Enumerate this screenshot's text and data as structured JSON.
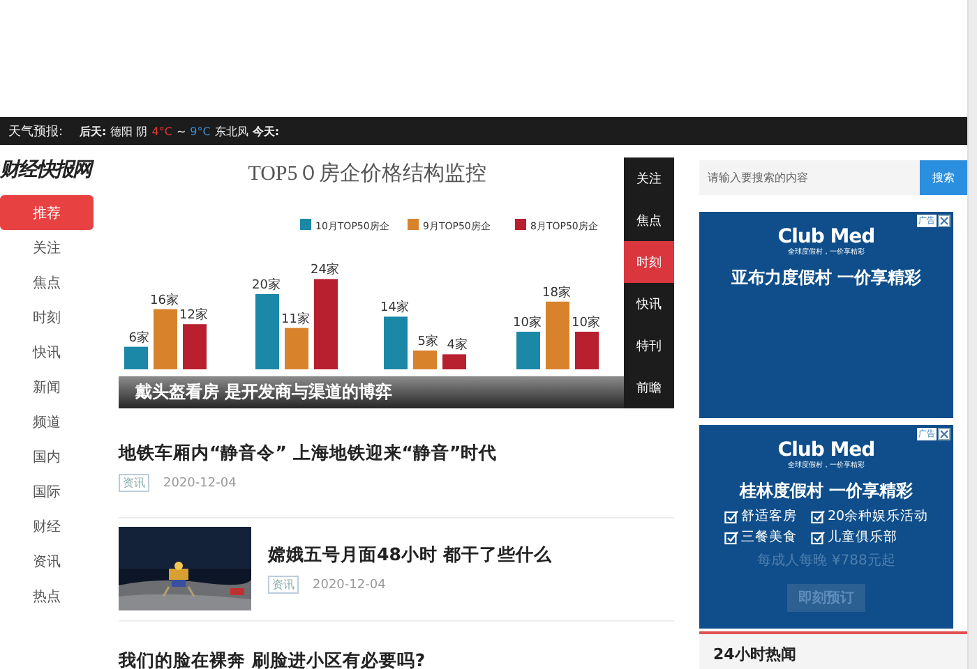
{
  "weather": {
    "label": "天气预报:",
    "segments": [
      {
        "text": "后天:",
        "bold": true
      },
      {
        "text": "德阳 阴",
        "bold": false
      },
      {
        "text": "4°C",
        "bold": false,
        "color": "#e53935"
      },
      {
        "text": "~",
        "bold": false
      },
      {
        "text": "9°C",
        "bold": false,
        "color": "#3d8fd1"
      },
      {
        "text": "东北风",
        "bold": false
      },
      {
        "text": "今天:",
        "bold": true
      }
    ]
  },
  "logo": "财经快报网",
  "nav": [
    {
      "label": "推荐",
      "selected": true
    },
    {
      "label": "关注",
      "selected": false
    },
    {
      "label": "焦点",
      "selected": false
    },
    {
      "label": "时刻",
      "selected": false
    },
    {
      "label": "快讯",
      "selected": false
    },
    {
      "label": "新闻",
      "selected": false
    },
    {
      "label": "频道",
      "selected": false
    },
    {
      "label": "国内",
      "selected": false
    },
    {
      "label": "国际",
      "selected": false
    },
    {
      "label": "财经",
      "selected": false
    },
    {
      "label": "资讯",
      "selected": false
    },
    {
      "label": "热点",
      "selected": false
    }
  ],
  "hero": {
    "caption": "戴头盔看房 是开发商与渠道的博弈",
    "label_units": [
      [
        "家",
        "家",
        "家",
        "家"
      ],
      [
        "家",
        "家",
        "家",
        "家"
      ],
      [
        "家",
        "家",
        "家",
        "家"
      ]
    ],
    "chart_data": {
      "type": "bar",
      "title": "TOP5０房企价格结构监控",
      "legend": "top",
      "data_labels": true,
      "series": [
        {
          "name": "10月TOP50房企",
          "color": "#1b88a8",
          "values": [
            6,
            20,
            14,
            10
          ]
        },
        {
          "name": "9月TOP50房企",
          "color": "#d8822c",
          "values": [
            16,
            11,
            5,
            18
          ]
        },
        {
          "name": "8月TOP50房企",
          "color": "#b81f2f",
          "values": [
            12,
            24,
            4,
            10
          ]
        }
      ]
    },
    "menu": [
      {
        "label": "关注",
        "selected": false
      },
      {
        "label": "焦点",
        "selected": false
      },
      {
        "label": "时刻",
        "selected": true
      },
      {
        "label": "快讯",
        "selected": false
      },
      {
        "label": "特刊",
        "selected": false
      },
      {
        "label": "前瞻",
        "selected": false
      }
    ]
  },
  "articles": [
    {
      "title": "地铁车厢内“静音令” 上海地铁迎来“静音”时代",
      "tag": "资讯",
      "date": "2020-12-04",
      "has_image": false
    },
    {
      "title": "嫦娥五号月面48小时 都干了些什么",
      "tag": "资讯",
      "date": "2020-12-04",
      "has_image": true
    },
    {
      "title": "我们的脸在裸奔 刷脸进小区有必要吗?",
      "has_image": false
    }
  ],
  "search": {
    "placeholder": "请输入要搜索的内容",
    "button": "搜索"
  },
  "ads": [
    {
      "badge": "广告",
      "brand": "Club Med",
      "tagline": "全球度假村，一价享精彩",
      "headline": "亚布力度假村 一价享精彩"
    },
    {
      "badge": "广告",
      "brand": "Club Med",
      "tagline": "全球度假村，一价享精彩",
      "headline": "桂林度假村 一价享精彩",
      "features": [
        "舒适客房",
        "20余种娱乐活动",
        "三餐美食",
        "儿童俱乐部"
      ],
      "price": "每成人每晚 ¥788元起",
      "cta": "即刻预订"
    }
  ],
  "hot": {
    "title": "24小时热闻"
  }
}
